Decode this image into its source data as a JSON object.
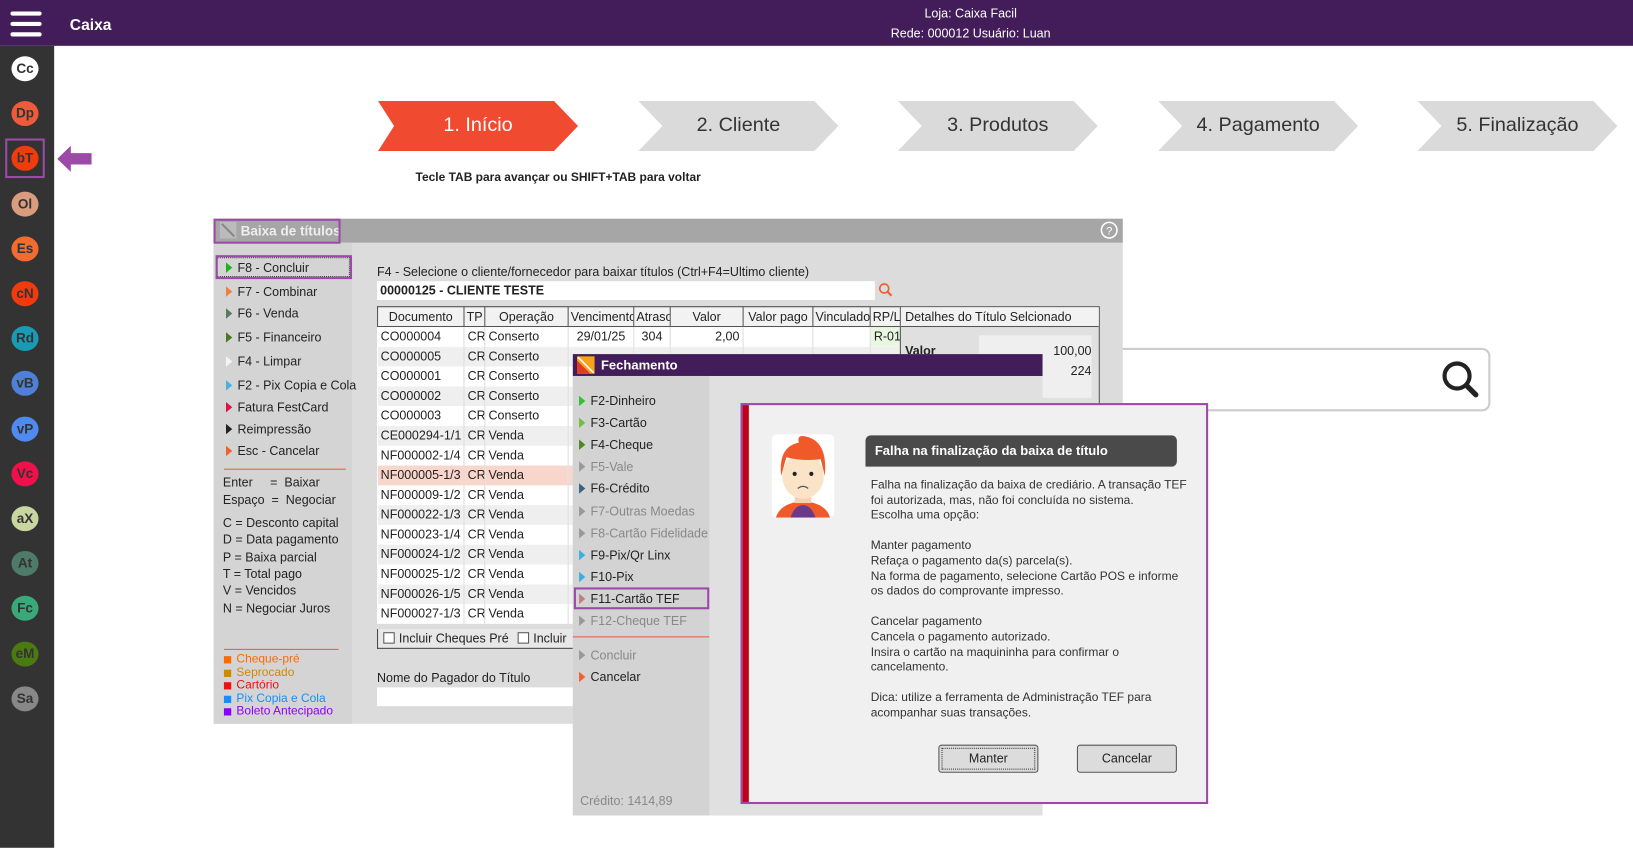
{
  "header": {
    "title": "Caixa",
    "store": "Loja: Caixa  Facil",
    "network": "Rede: 000012 Usuário: Luan"
  },
  "sidebar": [
    {
      "label": "Cc",
      "color": "#ffffff"
    },
    {
      "label": "Dp",
      "color": "#f05a3a"
    },
    {
      "label": "bT",
      "color": "#f03c0c"
    },
    {
      "label": "Ol",
      "color": "#d99c7c"
    },
    {
      "label": "Es",
      "color": "#f26b30"
    },
    {
      "label": "cN",
      "color": "#f03c0c"
    },
    {
      "label": "Rd",
      "color": "#1a9bb5"
    },
    {
      "label": "vB",
      "color": "#4f7fd6"
    },
    {
      "label": "vP",
      "color": "#4f8af0"
    },
    {
      "label": "Vc",
      "color": "#f0104c"
    },
    {
      "label": "aX",
      "color": "#c8d6a0"
    },
    {
      "label": "At",
      "color": "#4e7a6a"
    },
    {
      "label": "Fc",
      "color": "#3aa878"
    },
    {
      "label": "eM",
      "color": "#4a7a10"
    },
    {
      "label": "Sa",
      "color": "#888888"
    }
  ],
  "steps": [
    {
      "label": "1. Início",
      "active": true
    },
    {
      "label": "2. Cliente"
    },
    {
      "label": "3. Produtos"
    },
    {
      "label": "4. Pagamento"
    },
    {
      "label": "5. Finalização"
    }
  ],
  "hint": "Tecle TAB para avançar ou SHIFT+TAB para voltar",
  "baixa": {
    "title": "Baixa de títulos",
    "menu": [
      {
        "label": "F8 - Concluir",
        "color": "#1db31d"
      },
      {
        "label": "F7 - Combinar",
        "color": "#f08040"
      },
      {
        "label": "F6 - Venda",
        "color": "#5a7a60"
      },
      {
        "label": "F5 - Financeiro",
        "color": "#4a7a20"
      },
      {
        "label": "F4 - Limpar",
        "color": "#f4f4f4"
      },
      {
        "label": "F2 - Pix Copia e Cola",
        "color": "#4ab0e0"
      },
      {
        "label": "Fatura FestCard",
        "color": "#e0104a"
      },
      {
        "label": "Reimpressão",
        "color": "#222222"
      },
      {
        "label": "Esc - Cancelar",
        "color": "#f06030"
      }
    ],
    "keys": [
      "Enter     =  Baixar",
      "Espaço  =  Negociar"
    ],
    "codes": [
      "C = Desconto capital",
      "D = Data pagamento",
      "P = Baixa parcial",
      "T = Total pago",
      "V = Vencidos",
      "N = Negociar Juros"
    ],
    "legend": [
      {
        "label": "Cheque-pré",
        "color": "#ff6a00"
      },
      {
        "label": "Seprocado",
        "color": "#d08a00"
      },
      {
        "label": "Cartório",
        "color": "#f01010"
      },
      {
        "label": "Pix Copia e Cola",
        "color": "#1a8cff"
      },
      {
        "label": "Boleto Antecipado",
        "color": "#8a00ff"
      }
    ],
    "client_label": "F4 - Selecione o cliente/fornecedor para baixar títulos (Ctrl+F4=Ultimo cliente)",
    "client_value": "00000125 - CLIENTE TESTE",
    "columns": [
      "Documento",
      "TP",
      "Operação",
      "Vencimento",
      "Atraso",
      "Valor",
      "Valor pago",
      "Vinculado",
      "RP/L"
    ],
    "rows": [
      [
        "CO000004",
        "CR",
        "Conserto",
        "29/01/25",
        "304",
        "2,00",
        "",
        "",
        "R-01"
      ],
      [
        "CO000005",
        "CR",
        "Conserto",
        "",
        "",
        "",
        "",
        "",
        ""
      ],
      [
        "CO000001",
        "CR",
        "Conserto",
        "",
        "",
        "",
        "",
        "",
        ""
      ],
      [
        "CO000002",
        "CR",
        "Conserto",
        "",
        "",
        "",
        "",
        "",
        ""
      ],
      [
        "CO000003",
        "CR",
        "Conserto",
        "",
        "",
        "",
        "",
        "",
        ""
      ],
      [
        "CE000294-1/1",
        "CR",
        "Venda",
        "",
        "",
        "",
        "",
        "",
        ""
      ],
      [
        "NF000002-1/4",
        "CR",
        "Venda",
        "",
        "",
        "",
        "",
        "",
        ""
      ],
      [
        "NF000005-1/3",
        "CR",
        "Venda",
        "",
        "",
        "",
        "",
        "",
        ""
      ],
      [
        "NF000009-1/2",
        "CR",
        "Venda",
        "",
        "",
        "",
        "",
        "",
        ""
      ],
      [
        "NF000022-1/3",
        "CR",
        "Venda",
        "",
        "",
        "",
        "",
        "",
        ""
      ],
      [
        "NF000023-1/4",
        "CR",
        "Venda",
        "",
        "",
        "",
        "",
        "",
        ""
      ],
      [
        "NF000024-1/2",
        "CR",
        "Venda",
        "",
        "",
        "",
        "",
        "",
        ""
      ],
      [
        "NF000025-1/2",
        "CR",
        "Venda",
        "",
        "",
        "",
        "",
        "",
        ""
      ],
      [
        "NF000026-1/5",
        "CR",
        "Venda",
        "",
        "",
        "",
        "",
        "",
        ""
      ],
      [
        "NF000027-1/3",
        "CR",
        "Venda",
        "",
        "",
        "",
        "",
        "",
        ""
      ]
    ],
    "selected_row": 7,
    "checkboxes": [
      "Incluir Cheques Pré",
      "Incluir"
    ],
    "details_title": "Detalhes do Título Selcionado",
    "details_label": "Valor",
    "details_values": [
      "100,00",
      "224"
    ],
    "payer_label": "Nome do Pagador do Título"
  },
  "fechamento": {
    "title": "Fechamento",
    "items": [
      {
        "label": "F2-Dinheiro",
        "color": "#30c030",
        "enabled": true
      },
      {
        "label": "F3-Cartão",
        "color": "#70c040",
        "enabled": true
      },
      {
        "label": "F4-Cheque",
        "color": "#4a8a20",
        "enabled": true
      },
      {
        "label": "F5-Vale",
        "color": "#999999",
        "enabled": false
      },
      {
        "label": "F6-Crédito",
        "color": "#3a6080",
        "enabled": true
      },
      {
        "label": "F7-Outras Moedas",
        "color": "#999999",
        "enabled": false
      },
      {
        "label": "F8-Cartão Fidelidade",
        "color": "#999999",
        "enabled": false
      },
      {
        "label": "F9-Pix/Qr Linx",
        "color": "#3ab0e0",
        "enabled": true
      },
      {
        "label": "F10-Pix",
        "color": "#3ab0e0",
        "enabled": true
      },
      {
        "label": "F11-Cartão TEF",
        "color": "#c08080",
        "enabled": true
      },
      {
        "label": "F12-Cheque TEF",
        "color": "#999999",
        "enabled": false
      }
    ],
    "actions": [
      {
        "label": "Concluir",
        "color": "#999999",
        "enabled": false
      },
      {
        "label": "Cancelar",
        "color": "#f06030",
        "enabled": true
      }
    ],
    "credit": "Crédito: 1414,89"
  },
  "alert": {
    "title": "Falha na finalização da baixa de título",
    "lines": [
      "Falha na finalização da baixa de crediário. A transação TEF",
      "foi autorizada, mas, não foi concluída no sistema.",
      "Escolha uma opção:",
      "",
      "Manter pagamento",
      "Refaça o pagamento da(s) parcela(s).",
      "Na forma de pagamento, selecione Cartão POS e informe",
      "os dados do comprovante impresso.",
      "",
      "Cancelar pagamento",
      "Cancela o pagamento autorizado.",
      "Insira o cartão na maquininha para confirmar o",
      "cancelamento.",
      "",
      "Dica: utilize a ferramenta de Administração TEF para",
      "acompanhar suas transações."
    ],
    "keep_button": "Manter",
    "cancel_button": "Cancelar"
  },
  "colors": {
    "header": "#431d5a",
    "accent": "#f04a30",
    "highlight": "#9b4aa8",
    "alert_bar": "#c0001a"
  }
}
